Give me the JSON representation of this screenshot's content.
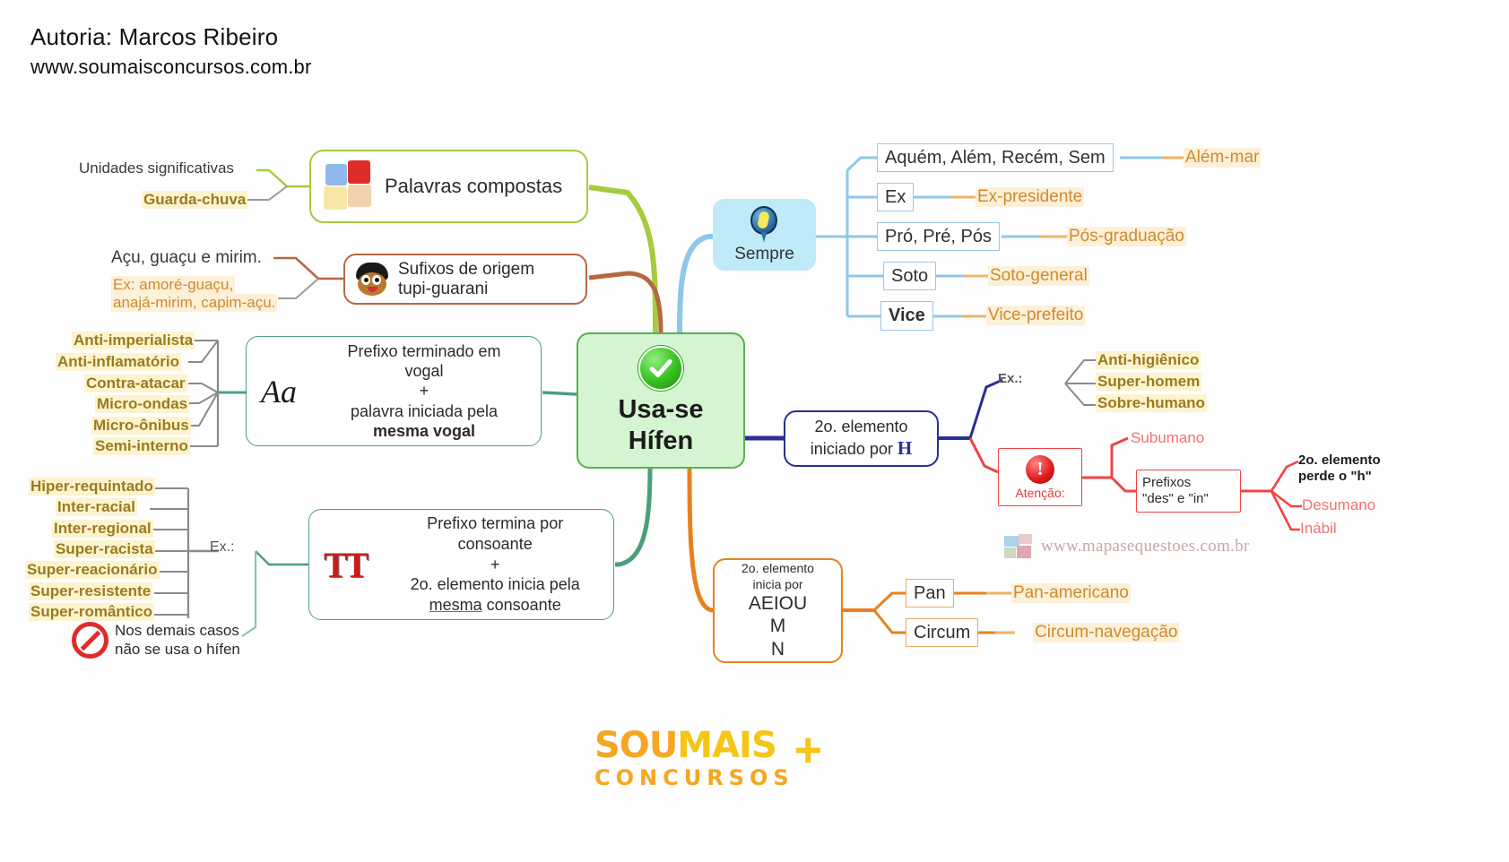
{
  "header": {
    "author": "Autoria: Marcos Ribeiro",
    "site": "www.soumaisconcursos.com.br"
  },
  "central": {
    "line1": "Usa-se",
    "line2": "Hífen",
    "icon": "green-check-icon"
  },
  "branches": {
    "palavras_compostas": {
      "label": "Palavras compostas",
      "icon": "puzzle-icon",
      "leaves": [
        "Unidades significativas",
        "Guarda-chuva"
      ]
    },
    "tupi_guarani": {
      "label_line1": "Sufixos de origem",
      "label_line2": "tupi-guarani",
      "icon": "face-icon",
      "leaves": [
        "Açu, guaçu e mirim.",
        "Ex: amoré-guaçu,",
        "anajá-mirim, capim-açu."
      ]
    },
    "prefixo_vogal": {
      "icon_text": "Aa",
      "line1": "Prefixo terminado em",
      "line2": "vogal",
      "plus": "+",
      "line3": "palavra iniciada pela",
      "line4": "mesma vogal",
      "examples": [
        "Anti-imperialista",
        "Anti-inflamatório",
        "Contra-atacar",
        "Micro-ondas",
        "Micro-ônibus",
        "Semi-interno"
      ]
    },
    "prefixo_consoante": {
      "icon_text": "TT",
      "line1": "Prefixo termina por",
      "line2": "consoante",
      "plus": "+",
      "line3": "2o. elemento inicia pela",
      "line4_underline": "mesma",
      "line4_rest": " consoante",
      "ex_label": "Ex.:",
      "examples": [
        "Hiper-requintado",
        "Inter-racial",
        "Inter-regional",
        "Super-racista",
        "Super-reacionário",
        "Super-resistente",
        "Super-romântico"
      ],
      "note_line1": "Nos demais casos",
      "note_line2": "não se usa o hífen",
      "note_icon": "prohibition-icon"
    },
    "sempre": {
      "label": "Sempre",
      "icon": "magnifier-icon",
      "items": [
        {
          "keyword": "Aquém, Além, Recém, Sem",
          "example": "Além-mar",
          "bold": false
        },
        {
          "keyword": "Ex",
          "example": "Ex-presidente",
          "bold": false
        },
        {
          "keyword": "Pró, Pré, Pós",
          "example": "Pós-graduação",
          "bold": false
        },
        {
          "keyword": "Soto",
          "example": "Soto-general",
          "bold": false
        },
        {
          "keyword": "Vice",
          "example": "Vice-prefeito",
          "bold": true
        }
      ]
    },
    "elemento_h": {
      "line1": "2o. elemento",
      "line2_prefix": "iniciado por ",
      "line2_letter": "H",
      "ex_label": "Ex.:",
      "examples": [
        "Anti-higiênico",
        "Super-homem",
        "Sobre-humano"
      ],
      "atencao": {
        "label": "Atenção:",
        "icon": "warning-icon",
        "leaf_top": "Subumano",
        "prefixos_line1": "Prefixos",
        "prefixos_line2": "\"des\" e \"in\"",
        "results": [
          "2o. elemento\nperde o \"h\"",
          "Desumano",
          "Inábil"
        ]
      }
    },
    "elemento_aeiou": {
      "line1": "2o. elemento",
      "line2": "inicia por",
      "line3": "AEIOU",
      "line4": "M",
      "line5": "N",
      "items": [
        {
          "keyword": "Pan",
          "example": "Pan-americano"
        },
        {
          "keyword": "Circum",
          "example": "Circum-navegação"
        }
      ]
    }
  },
  "watermark": "www.mapasequestoes.com.br",
  "logo": {
    "line1_a": "SOU",
    "line1_b": "MAIS",
    "line2": "CONCURSOS",
    "plus": "+"
  },
  "colors": {
    "green": "#4aa07a",
    "olive": "#a5cb3e",
    "brown": "#b5693f",
    "navy": "#2b2e94",
    "orange": "#e8811d",
    "red": "#ef4444",
    "blue": "#9cc6ea",
    "cyan_bg": "#bfeaf7",
    "highlight": "#fdf3cf",
    "highlight_text": "#9a7b1f"
  }
}
